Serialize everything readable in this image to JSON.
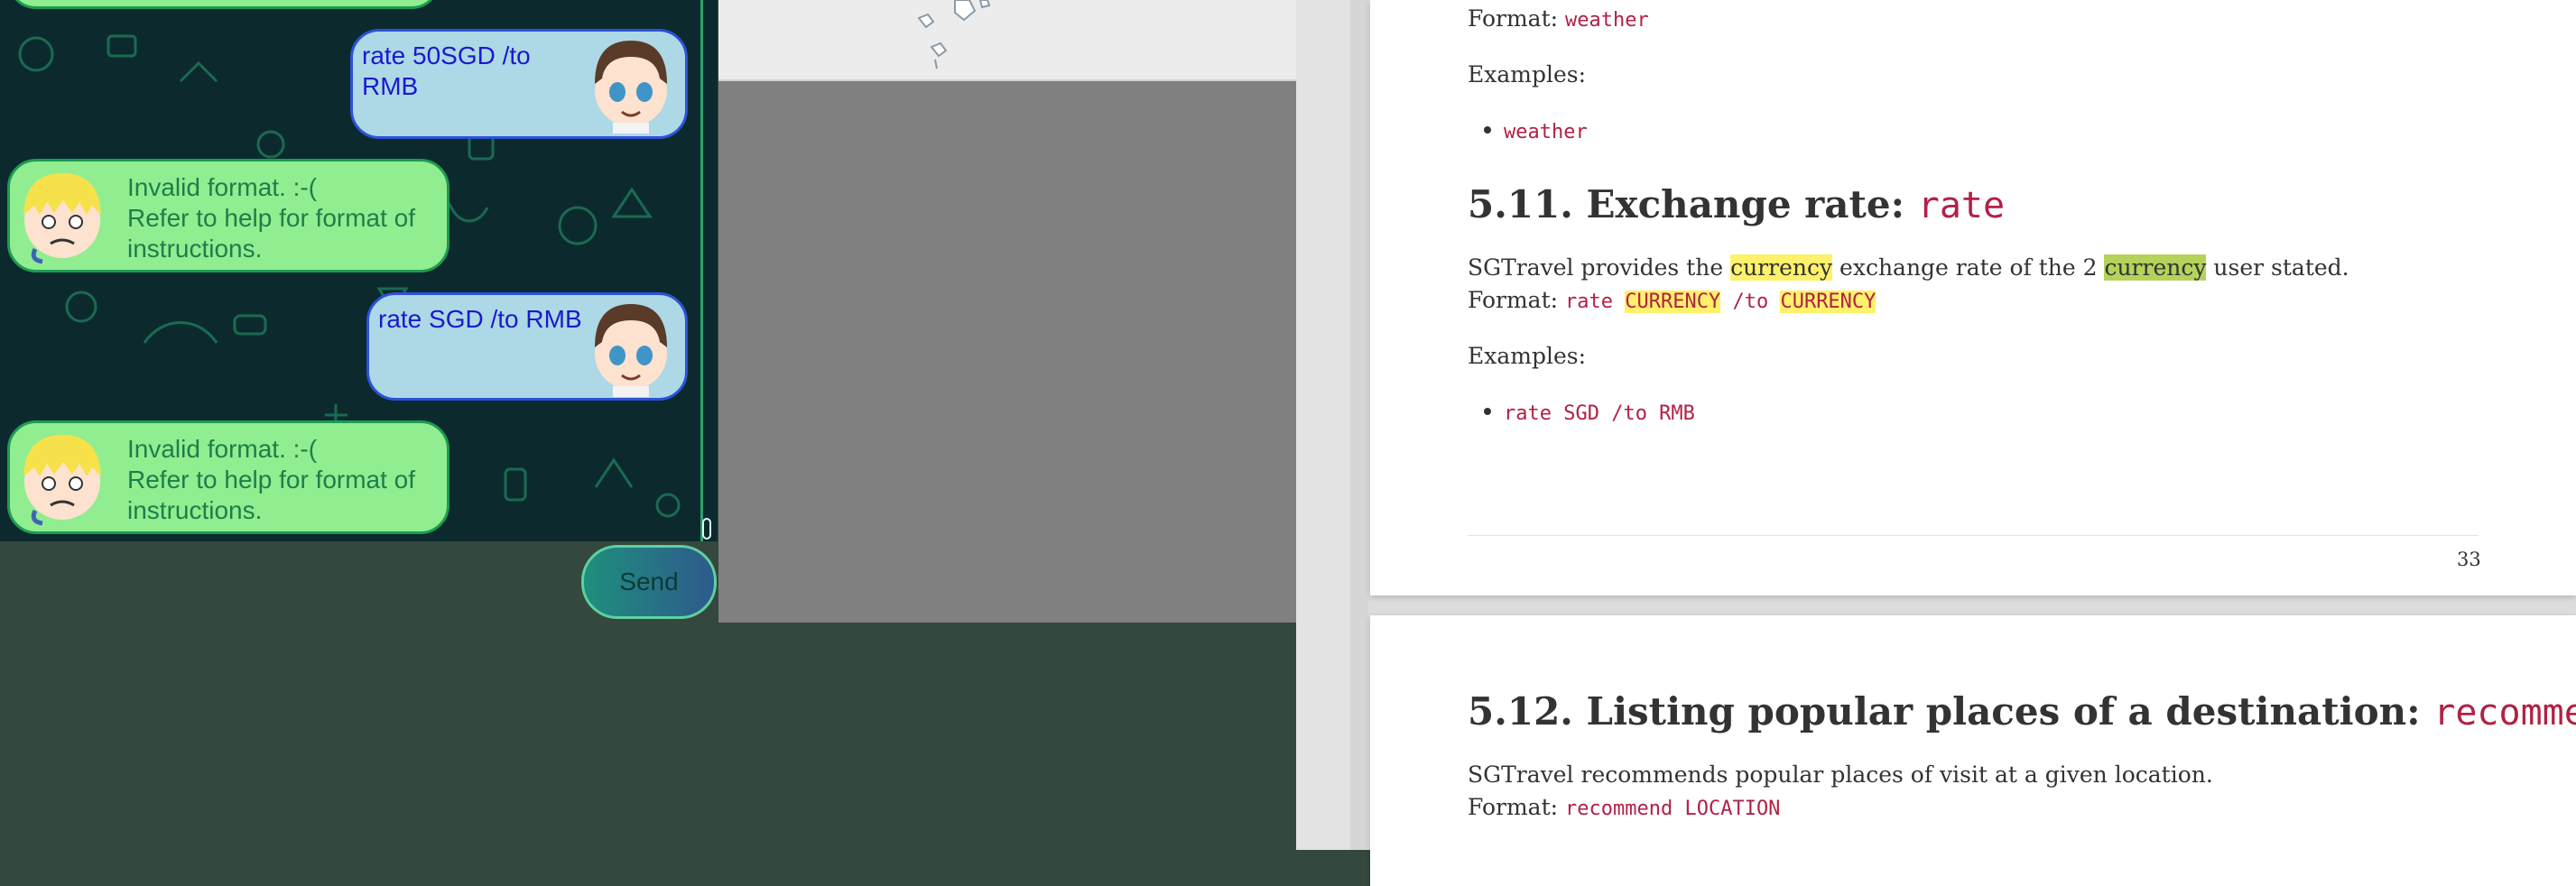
{
  "chat": {
    "messages": [
      {
        "sender": "user",
        "text": "rate 50SGD /to\nRMB"
      },
      {
        "sender": "bot",
        "text": "Invalid format. :-(\nRefer to help for format of\ninstructions."
      },
      {
        "sender": "user",
        "text": "rate SGD /to RMB"
      },
      {
        "sender": "bot",
        "text": "Invalid format. :-(\nRefer to help for format of\ninstructions."
      }
    ],
    "send_label": "Send"
  },
  "doc": {
    "prev_format_label": "Format:",
    "prev_format_code": "weather",
    "prev_examples_label": "Examples:",
    "prev_example": "weather",
    "section_heading_text": "5.11. Exchange rate: ",
    "section_heading_code": "rate",
    "desc_part1": "SGTravel provides the ",
    "desc_hl1": "currency",
    "desc_part2": " exchange rate of the 2 ",
    "desc_hl2": "currency",
    "desc_part3": " user stated.",
    "format_label": "Format:",
    "format_code1": "rate ",
    "format_hl1": "CURRENCY",
    "format_code2": " /to ",
    "format_hl2": "CURRENCY",
    "examples_label": "Examples:",
    "example": "rate SGD /to RMB",
    "page_number": "33",
    "next_heading_text": "5.12. Listing popular places of a destination: ",
    "next_heading_code": "recommend",
    "next_desc": "SGTravel recommends popular places of visit at a given location.",
    "next_format_label": "Format:",
    "next_format_code": "recommend LOCATION"
  },
  "colors": {
    "user_bubble": "#add8e6",
    "bot_bubble": "#90ee90",
    "code_text": "#b12146",
    "highlight_yellow": "#fff16a",
    "highlight_green": "#b5d35a"
  }
}
